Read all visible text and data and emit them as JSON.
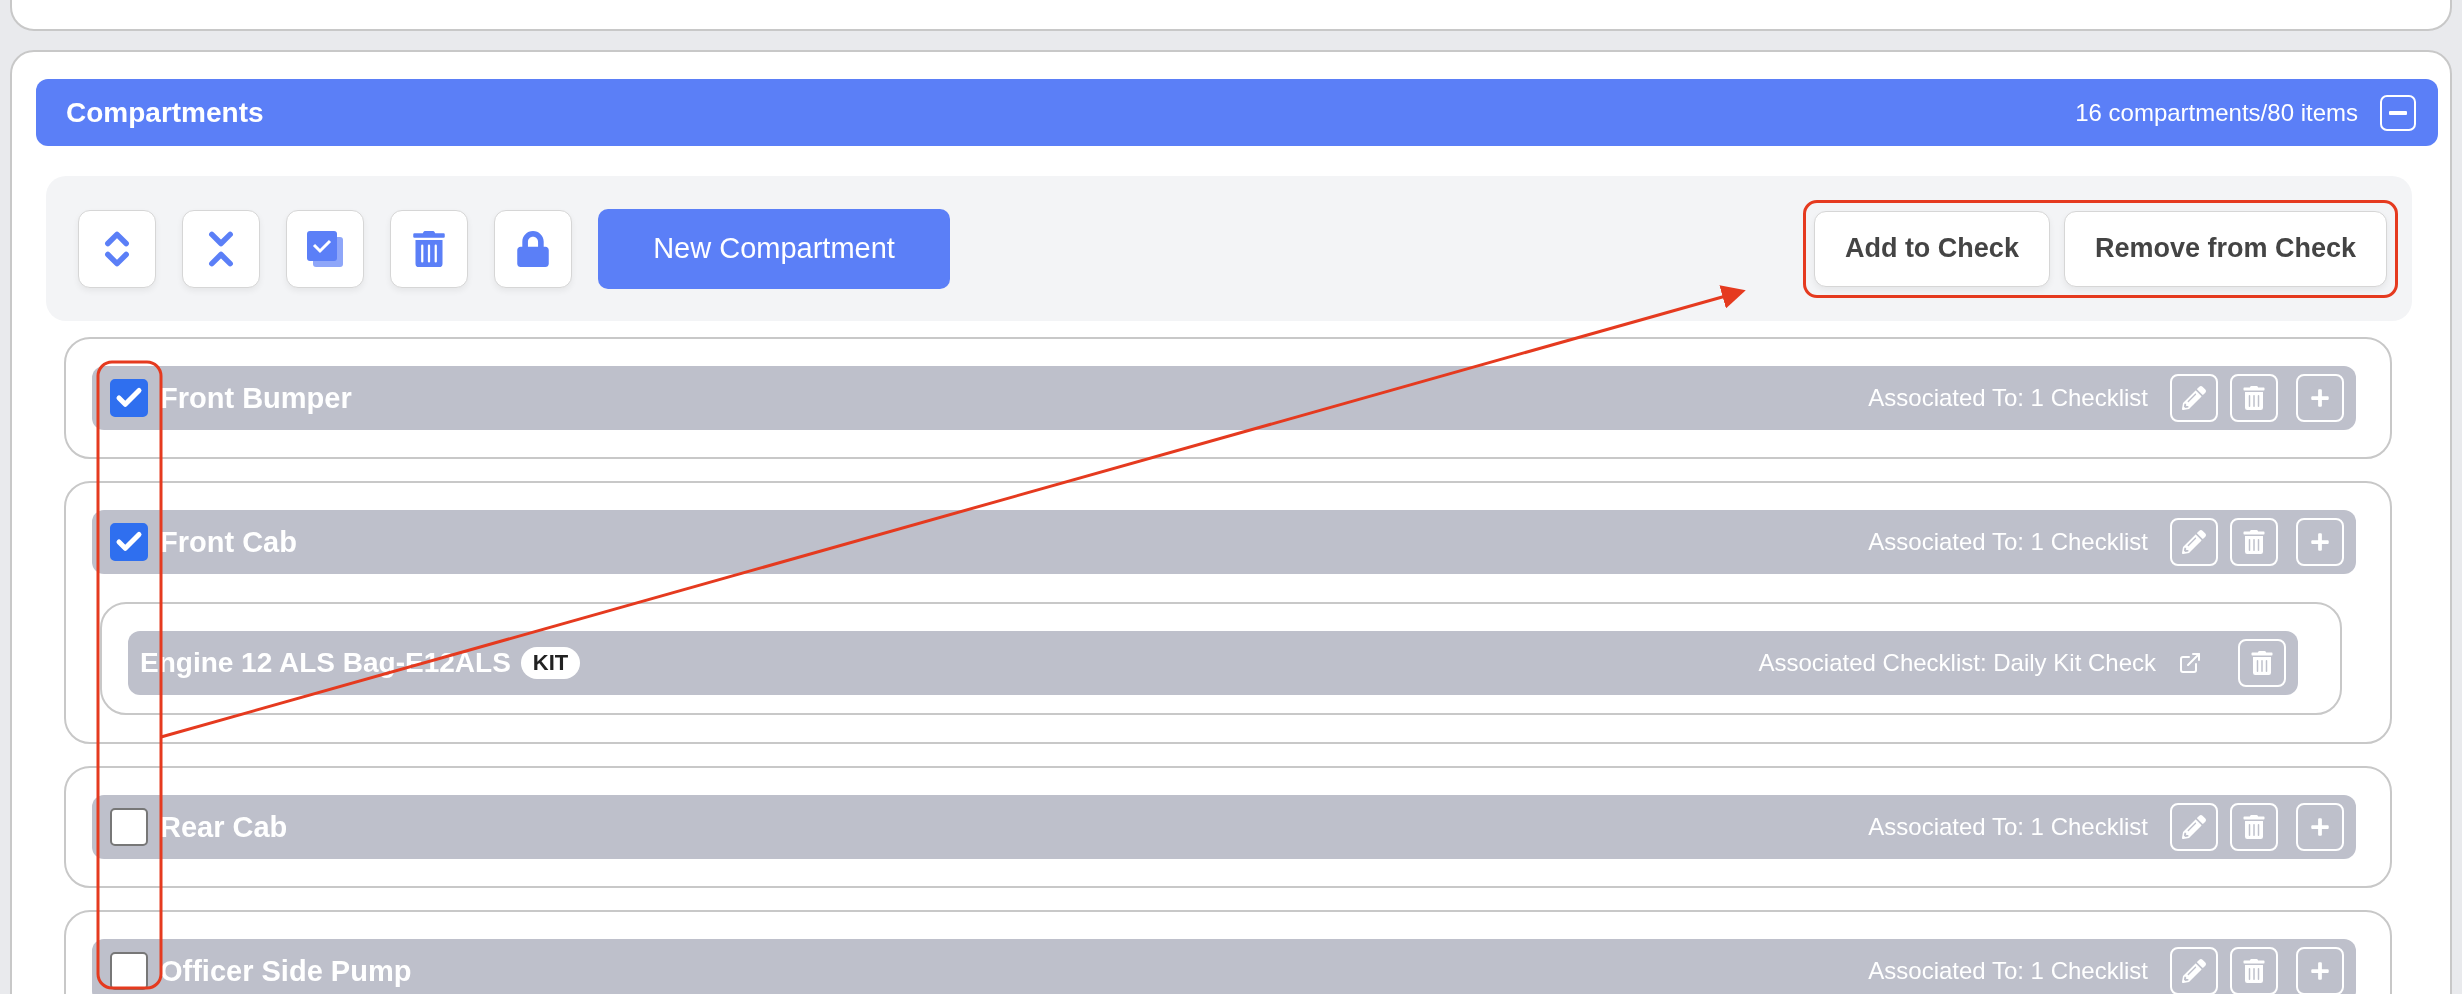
{
  "section": {
    "title": "Compartments",
    "summary": "16 compartments/80 items"
  },
  "toolbar": {
    "new_button": "New Compartment",
    "actions": [
      "Add to Check",
      "Remove from Check"
    ]
  },
  "compartments": [
    {
      "name": "Front Bumper",
      "checked": true,
      "association": "Associated To: 1 Checklist"
    },
    {
      "name": "Front Cab",
      "checked": true,
      "association": "Associated To: 1 Checklist",
      "items": [
        {
          "name": "Engine 12 ALS Bag-E12ALS",
          "badge": "KIT",
          "association": "Associated Checklist: Daily Kit Check"
        }
      ]
    },
    {
      "name": "Rear Cab",
      "checked": false,
      "association": "Associated To: 1 Checklist"
    },
    {
      "name": "Officer Side Pump",
      "checked": false,
      "association": "Associated To: 1 Checklist"
    }
  ]
}
